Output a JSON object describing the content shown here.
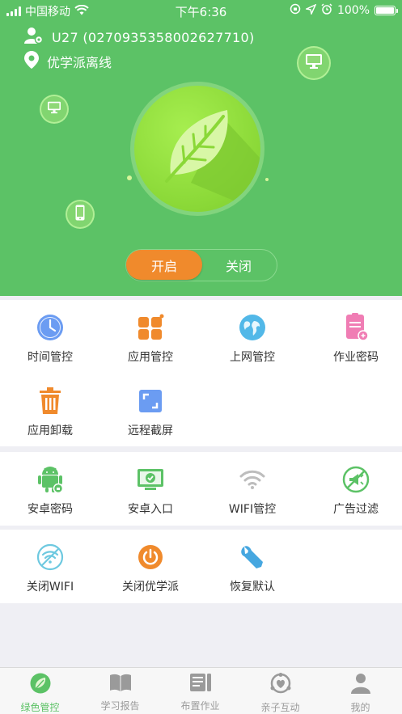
{
  "status_bar": {
    "carrier": "中国移动",
    "time": "下午6:36",
    "battery": "100%",
    "battery_level": 1.0
  },
  "device": {
    "user_label": "U27 (0270935358002627710)",
    "location_status": "优学派离线"
  },
  "toggle": {
    "on_label": "开启",
    "off_label": "关闭",
    "selected": "on"
  },
  "colors": {
    "brand_green": "#5cc266",
    "accent_orange": "#f08a2c",
    "leaf_green": "#8ad837"
  },
  "grid1": [
    {
      "label": "时间管控",
      "icon": "clock-icon"
    },
    {
      "label": "应用管控",
      "icon": "apps-icon"
    },
    {
      "label": "上网管控",
      "icon": "globe-icon"
    },
    {
      "label": "作业密码",
      "icon": "homework-password-icon"
    },
    {
      "label": "应用卸载",
      "icon": "trash-icon"
    },
    {
      "label": "远程截屏",
      "icon": "screenshot-icon"
    }
  ],
  "grid2": [
    {
      "label": "安卓密码",
      "icon": "android-lock-icon"
    },
    {
      "label": "安卓入口",
      "icon": "android-entry-icon"
    },
    {
      "label": "WIFI管控",
      "icon": "wifi-icon"
    },
    {
      "label": "广告过滤",
      "icon": "ad-block-icon"
    }
  ],
  "grid3": [
    {
      "label": "关闭WIFI",
      "icon": "wifi-off-icon"
    },
    {
      "label": "关闭优学派",
      "icon": "power-icon"
    },
    {
      "label": "恢复默认",
      "icon": "wrench-icon"
    }
  ],
  "tabs": [
    {
      "label": "绿色管控",
      "icon": "leaf-icon",
      "active": true
    },
    {
      "label": "学习报告",
      "icon": "book-icon",
      "active": false
    },
    {
      "label": "布置作业",
      "icon": "assignment-icon",
      "active": false
    },
    {
      "label": "亲子互动",
      "icon": "heart-interaction-icon",
      "active": false
    },
    {
      "label": "我的",
      "icon": "profile-icon",
      "active": false
    }
  ]
}
